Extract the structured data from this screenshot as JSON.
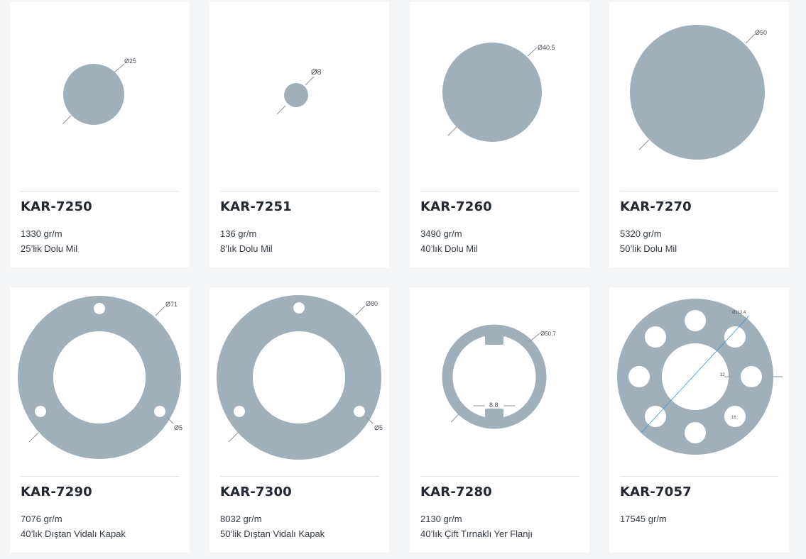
{
  "colors": {
    "part_fill": "#a0b0bb",
    "background": "#f4f5f7",
    "card": "#ffffff"
  },
  "products": [
    {
      "code": "KAR-7250",
      "weight": "1330 gr/m",
      "description": "25’lik Dolu Mil",
      "dims": [
        "Ø25"
      ]
    },
    {
      "code": "KAR-7251",
      "weight": "136 gr/m",
      "description": "8’lık Dolu Mil",
      "dims": [
        "Ø8"
      ]
    },
    {
      "code": "KAR-7260",
      "weight": "3490 gr/m",
      "description": "40’lık Dolu Mil",
      "dims": [
        "Ø40.5"
      ]
    },
    {
      "code": "KAR-7270",
      "weight": "5320 gr/m",
      "description": "50’lik Dolu Mil",
      "dims": [
        "Ø50"
      ]
    },
    {
      "code": "KAR-7290",
      "weight": "7076 gr/m",
      "description": "40’lık Dıştan Vidalı Kapak",
      "dims": [
        "Ø71",
        "Ø5"
      ]
    },
    {
      "code": "KAR-7300",
      "weight": "8032 gr/m",
      "description": "50’lik Dıştan Vidalı Kapak",
      "dims": [
        "Ø80",
        "Ø5"
      ]
    },
    {
      "code": "KAR-7280",
      "weight": "2130 gr/m",
      "description": "40’lık Çift Tırnaklı Yer Flanjı",
      "dims": [
        "Ø50.7",
        "8.8"
      ]
    },
    {
      "code": "KAR-7057",
      "weight": "17545 gr/m",
      "description": "",
      "dims": [
        "Ø112.4",
        "32",
        "16"
      ]
    }
  ]
}
